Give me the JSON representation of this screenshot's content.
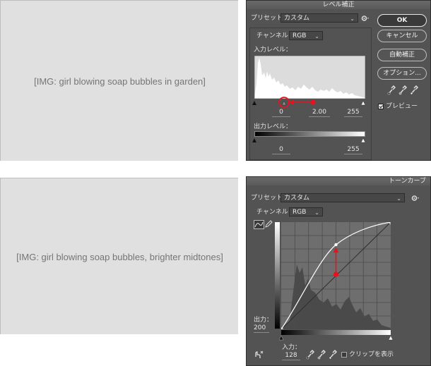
{
  "levels": {
    "title": "レベル補正",
    "preset_label": "プリセット：",
    "preset_value": "カスタム",
    "channel_label": "チャンネル：",
    "channel_value": "RGB",
    "input_levels_label": "入力レベル：",
    "input_black": "0",
    "input_gamma": "2.00",
    "input_white": "255",
    "output_levels_label": "出力レベル：",
    "output_black": "0",
    "output_white": "255",
    "buttons": {
      "ok": "OK",
      "cancel": "キャンセル",
      "auto": "自動補正",
      "options": "オプション..."
    },
    "preview_label": "プレビュー",
    "preview_checked": true
  },
  "curves": {
    "title": "トーンカーブ",
    "preset_label": "プリセット：",
    "preset_value": "カスタム",
    "channel_label": "チャンネル：",
    "channel_value": "RGB",
    "output_label": "出力：",
    "output_value": "200",
    "input_label": "入力：",
    "input_value": "128",
    "clip_label": "クリップを表示",
    "clip_checked": false
  },
  "annotations": {
    "color": "#e8121e"
  },
  "icons": [
    "gear-icon",
    "eyedropper-black-icon",
    "eyedropper-gray-icon",
    "eyedropper-white-icon",
    "curve-point-icon",
    "pencil-icon",
    "target-adjust-icon"
  ]
}
